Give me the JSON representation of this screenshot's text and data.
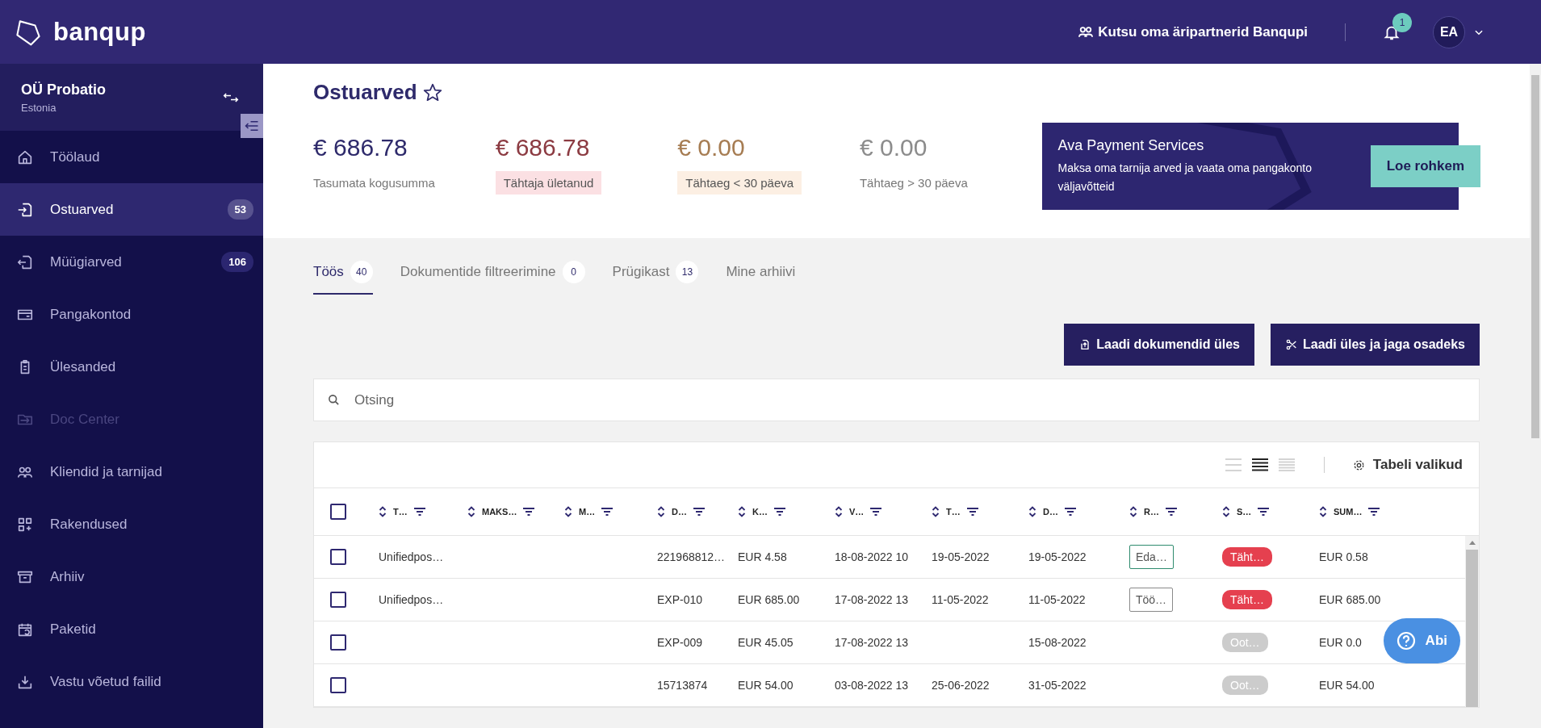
{
  "brand": {
    "name": "banqup"
  },
  "header": {
    "invite_link": "Kutsu oma äripartnerid Banqupi",
    "notification_count": "1",
    "avatar_initials": "EA"
  },
  "company": {
    "name": "OÜ Probatio",
    "country": "Estonia"
  },
  "sidebar": {
    "items": [
      {
        "label": "Töölaud",
        "selected": false,
        "disabled": false
      },
      {
        "label": "Ostuarved",
        "selected": true,
        "disabled": false,
        "badge": "53"
      },
      {
        "label": "Müügiarved",
        "selected": false,
        "disabled": false,
        "badge": "106"
      },
      {
        "label": "Pangakontod",
        "selected": false,
        "disabled": false
      },
      {
        "label": "Ülesanded",
        "selected": false,
        "disabled": false
      },
      {
        "label": "Doc Center",
        "selected": false,
        "disabled": true
      },
      {
        "label": "Kliendid ja tarnijad",
        "selected": false,
        "disabled": false
      },
      {
        "label": "Rakendused",
        "selected": false,
        "disabled": false
      },
      {
        "label": "Arhiiv",
        "selected": false,
        "disabled": false
      },
      {
        "label": "Paketid",
        "selected": false,
        "disabled": false
      },
      {
        "label": "Vastu võetud failid",
        "selected": false,
        "disabled": false
      }
    ]
  },
  "page": {
    "title": "Ostuarved",
    "favorite": false
  },
  "summary": [
    {
      "amount": "€ 686.78",
      "label": "Tasumata kogusumma",
      "kind": "total"
    },
    {
      "amount": "€ 686.78",
      "label": "Tähtaja ületanud",
      "kind": "overdue"
    },
    {
      "amount": "€ 0.00",
      "label": "Tähtaeg < 30 päeva",
      "kind": "soon"
    },
    {
      "amount": "€ 0.00",
      "label": "Tähtaeg > 30 päeva",
      "kind": "later"
    }
  ],
  "promo": {
    "title": "Ava Payment Services",
    "text": "Maksa oma tarnija arved ja vaata oma pangakonto väljavõtteid",
    "button": "Loe rohkem"
  },
  "tabs": [
    {
      "label": "Töös",
      "count": "40",
      "selected": true
    },
    {
      "label": "Dokumentide filtreerimine",
      "count": "0",
      "selected": false
    },
    {
      "label": "Prügikast",
      "count": "13",
      "selected": false
    },
    {
      "label": "Mine arhiivi",
      "selected": false
    }
  ],
  "actions": [
    {
      "label": "Laadi dokumendid üles"
    },
    {
      "label": "Laadi üles ja jaga osadeks"
    }
  ],
  "search": {
    "placeholder": "Otsing"
  },
  "table": {
    "view_modes": [
      {
        "selected": false
      },
      {
        "selected": true
      },
      {
        "selected": false
      }
    ],
    "options_button": "Tabeli valikud",
    "select_all": false,
    "columns": [
      "T…",
      "MAKS…",
      "M…",
      "D…",
      "K…",
      "V…",
      "T…",
      "D…",
      "R…",
      "S…",
      "SUM…"
    ],
    "rows": [
      {
        "checked": false,
        "cells": [
          {
            "kind": "text",
            "text": "Unifiedpos…"
          },
          {
            "kind": "empty"
          },
          {
            "kind": "empty"
          },
          {
            "kind": "text",
            "text": "221968812…"
          },
          {
            "kind": "text",
            "text": "EUR 4.58"
          },
          {
            "kind": "text",
            "text": "18-08-2022 10"
          },
          {
            "kind": "text",
            "text": "19-05-2022"
          },
          {
            "kind": "text",
            "text": "19-05-2022"
          },
          {
            "kind": "tag",
            "text": "Eda…",
            "color": "#2e8b6e"
          },
          {
            "kind": "status",
            "text": "Täht…",
            "color": "#e5404f"
          },
          {
            "kind": "text",
            "text": "EUR 0.58"
          }
        ]
      },
      {
        "checked": false,
        "cells": [
          {
            "kind": "text",
            "text": "Unifiedpos…"
          },
          {
            "kind": "empty"
          },
          {
            "kind": "empty"
          },
          {
            "kind": "text",
            "text": "EXP-010"
          },
          {
            "kind": "text",
            "text": "EUR 685.00"
          },
          {
            "kind": "text",
            "text": "17-08-2022 13"
          },
          {
            "kind": "text",
            "text": "11-05-2022"
          },
          {
            "kind": "text",
            "text": "11-05-2022"
          },
          {
            "kind": "tag",
            "text": "Töö…",
            "color": "#8a8a8a"
          },
          {
            "kind": "status",
            "text": "Täht…",
            "color": "#e5404f"
          },
          {
            "kind": "text",
            "text": "EUR 685.00"
          }
        ]
      },
      {
        "checked": false,
        "cells": [
          {
            "kind": "empty"
          },
          {
            "kind": "empty"
          },
          {
            "kind": "empty"
          },
          {
            "kind": "text",
            "text": "EXP-009"
          },
          {
            "kind": "text",
            "text": "EUR 45.05"
          },
          {
            "kind": "text",
            "text": "17-08-2022 13"
          },
          {
            "kind": "empty"
          },
          {
            "kind": "text",
            "text": "15-08-2022"
          },
          {
            "kind": "empty"
          },
          {
            "kind": "status",
            "text": "Oot…",
            "color": "#cccccc"
          },
          {
            "kind": "text",
            "text": "EUR 0.0"
          }
        ]
      },
      {
        "checked": false,
        "cells": [
          {
            "kind": "empty"
          },
          {
            "kind": "empty"
          },
          {
            "kind": "empty"
          },
          {
            "kind": "text",
            "text": "15713874"
          },
          {
            "kind": "text",
            "text": "EUR 54.00"
          },
          {
            "kind": "text",
            "text": "03-08-2022 13"
          },
          {
            "kind": "text",
            "text": "25-06-2022"
          },
          {
            "kind": "text",
            "text": "31-05-2022"
          },
          {
            "kind": "empty"
          },
          {
            "kind": "status",
            "text": "Oot…",
            "color": "#cccccc"
          },
          {
            "kind": "text",
            "text": "EUR 54.00"
          }
        ]
      }
    ]
  },
  "help_button": {
    "label": "Abi"
  }
}
